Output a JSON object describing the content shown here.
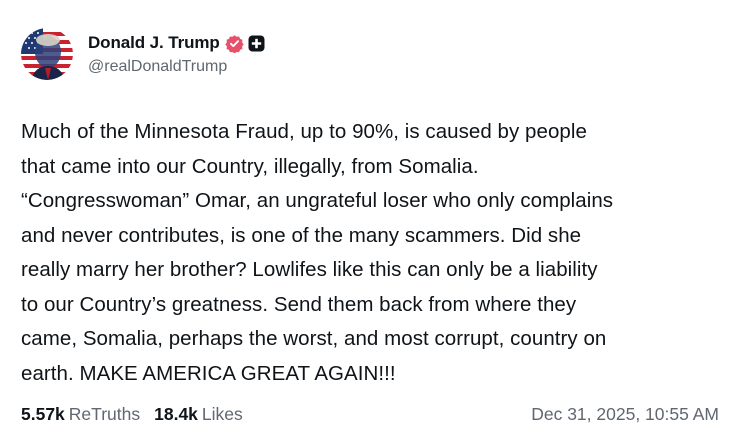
{
  "post": {
    "author": {
      "display_name": "Donald J. Trump",
      "handle": "@realDonaldTrump",
      "verified_icon": "verified-badge-icon",
      "plus_icon": "plus-square-icon",
      "avatar": "profile-avatar"
    },
    "text_lines": [
      "Much of the Minnesota Fraud, up to 90%, is caused by people",
      "that came into our Country, illegally, from Somalia.",
      "“Congresswoman” Omar, an ungrateful loser who only complains",
      "and never contributes, is one of the many scammers. Did she",
      "really marry her brother? Lowlifes like this can only be a liability",
      "to our Country’s greatness. Send them back from where they",
      "came, Somalia, perhaps the worst, and most corrupt, country on",
      "earth. MAKE AMERICA GREAT AGAIN!!!"
    ],
    "stats": {
      "retruths_count": "5.57k",
      "retruths_label": "ReTruths",
      "likes_count": "18.4k",
      "likes_label": "Likes"
    },
    "timestamp": "Dec 31, 2025, 10:55 AM"
  },
  "colors": {
    "text_primary": "#0f1419",
    "text_secondary": "#606770",
    "verified_badge": "#e8506a",
    "background": "#ffffff"
  }
}
